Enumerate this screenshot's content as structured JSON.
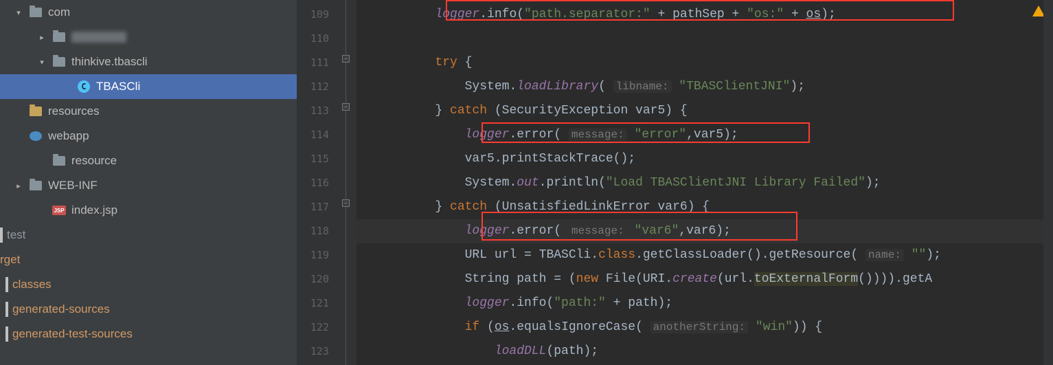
{
  "tree": {
    "com": "com",
    "thinkive": "thinkive.tbascli",
    "tbascli_class": "TBASCli",
    "resources": "resources",
    "webapp": "webapp",
    "resource": "resource",
    "webinf": "WEB-INF",
    "indexjsp": "index.jsp",
    "test": "test"
  },
  "excluded": {
    "rget": "rget",
    "classes": "classes",
    "gensrc": "generated-sources",
    "gentestsrc": "generated-test-sources"
  },
  "gutter": {
    "l0": "109",
    "l1": "110",
    "l2": "111",
    "l3": "112",
    "l4": "113",
    "l5": "114",
    "l6": "115",
    "l7": "116",
    "l8": "117",
    "l9": "118",
    "l10": "119",
    "l11": "120",
    "l12": "121",
    "l13": "122",
    "l14": "123"
  },
  "code": {
    "c109_logger": "logger",
    "c109_info": ".info(",
    "c109_s1": "\"path.separator:\"",
    "c109_plus1": " + pathSep + ",
    "c109_s2": "\"os:\"",
    "c109_plus2": " + ",
    "c109_os": "os",
    "c109_end": ");",
    "c111_try": "try",
    "c111_brace": " {",
    "c112_pre": "    System.",
    "c112_load": "loadLibrary",
    "c112_open": "( ",
    "c112_hint": "libname:",
    "c112_arg": " \"TBASClientJNI\"",
    "c112_end": ");",
    "c113_catch": "} ",
    "c113_kw": "catch",
    "c113_rest": " (SecurityException var5) {",
    "c114_logger": "logger",
    "c114_err": ".error( ",
    "c114_hint": "message:",
    "c114_arg": " \"error\"",
    "c114_rest": ",var5);",
    "c115": "    var5.printStackTrace();",
    "c116_pre": "    System.",
    "c116_out": "out",
    "c116_mid": ".println(",
    "c116_str": "\"Load TBASClientJNI Library Failed\"",
    "c116_end": ");",
    "c117_catch": "} ",
    "c117_kw": "catch",
    "c117_rest": " (UnsatisfiedLinkError var6) {",
    "c118_logger": "logger",
    "c118_err": ".error( ",
    "c118_hint": "message:",
    "c118_arg": " \"var6\"",
    "c118_rest": ",var6);",
    "c119_pre": "    URL url = TBASCli.",
    "c119_class": "class",
    "c119_mid": ".getClassLoader().getResource( ",
    "c119_hint": "name:",
    "c119_arg": " \"\"",
    "c119_end": ");",
    "c120_pre": "    String path = (",
    "c120_new": "new",
    "c120_mid": " File(URI.",
    "c120_create": "create",
    "c120_mid2": "(url.",
    "c120_ext": "toExternalForm",
    "c120_end": "()))).getA",
    "c121_logger": "logger",
    "c121_info": ".info(",
    "c121_s": "\"path:\"",
    "c121_end": " + path);",
    "c122_if": "if",
    "c122_open": " (",
    "c122_os": "os",
    "c122_mid": ".equalsIgnoreCase( ",
    "c122_hint": "anotherString:",
    "c122_arg": " \"win\"",
    "c122_end": ")) {",
    "c123_load": "loadDLL",
    "c123_rest": "(path);"
  }
}
